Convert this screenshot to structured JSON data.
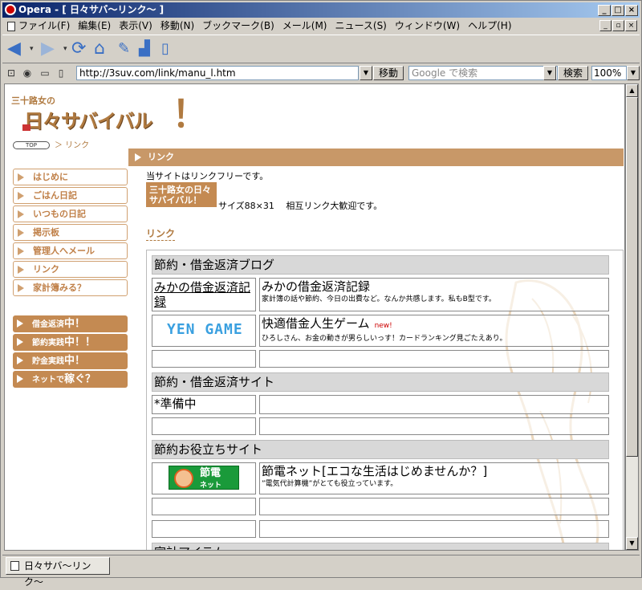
{
  "window": {
    "title": "Opera - [ 日々サバ〜リンク〜 ]",
    "controls": {
      "minimize": "_",
      "maximize": "□",
      "close": "×"
    }
  },
  "menu": [
    "ファイル(F)",
    "編集(E)",
    "表示(V)",
    "移動(N)",
    "ブックマーク(B)",
    "メール(M)",
    "ニュース(S)",
    "ウィンドウ(W)",
    "ヘルプ(H)"
  ],
  "addressbar": {
    "url": "http://3suv.com/link/manu_l.htm",
    "go_label": "移動",
    "search_placeholder": "Google で検索",
    "search_label": "検索",
    "zoom": "100%"
  },
  "status": {
    "tab_title": "日々サバ〜リンク〜"
  },
  "page": {
    "logo_top": "三十路女の",
    "logo_main": "日々サバイバル",
    "logo_ex": "！",
    "breadcrumb_top": "TOP",
    "breadcrumb_current": "＞ リンク",
    "sidenav": [
      "はじめに",
      "ごはん日記",
      "いつもの日記",
      "掲示板",
      "管理人へメール",
      "リンク",
      "家計簿みる？"
    ],
    "sidebuttons": [
      {
        "pre": "借金返済",
        "big": "中！"
      },
      {
        "pre": "節約実践",
        "big": "中！！"
      },
      {
        "pre": "貯金実践",
        "big": "中！"
      },
      {
        "pre": "ネットで",
        "big": "稼ぐ？"
      }
    ],
    "section_title": "リンク",
    "intro_line1": "当サイトはリンクフリーです。",
    "banner_text": "三十路女の日々サバイバル！",
    "intro_line2": "サイズ88×31　 相互リンク大歓迎です。",
    "link_heading": "リンク",
    "categories": [
      {
        "title": "節約・借金返済ブログ"
      },
      {
        "title": "節約・借金返済サイト"
      },
      {
        "title": "節約お役立ちサイト"
      },
      {
        "title": "家計アイテム"
      }
    ],
    "links": {
      "mika_name": "みかの借金返済記録",
      "mika_title": "みかの借金返済記録",
      "mika_desc": "家計簿の話や節約、今日の出費など。なんか共感します。私もB型です。",
      "yen_logo": "YEN GAME",
      "yen_title": "快適借金人生ゲーム",
      "yen_new": "new!",
      "yen_desc": "ひろしさん、お金の動きが男らしいっす！カードランキング見ごたえあり。",
      "prep": "*準備中",
      "setsu_logo": "節電",
      "setsu_logo_sub": "ネット",
      "setsu_title": "節電ネット[エコな生活はじめませんか？]",
      "setsu_desc": "”電気代計算機”がとても役立っています。"
    }
  }
}
